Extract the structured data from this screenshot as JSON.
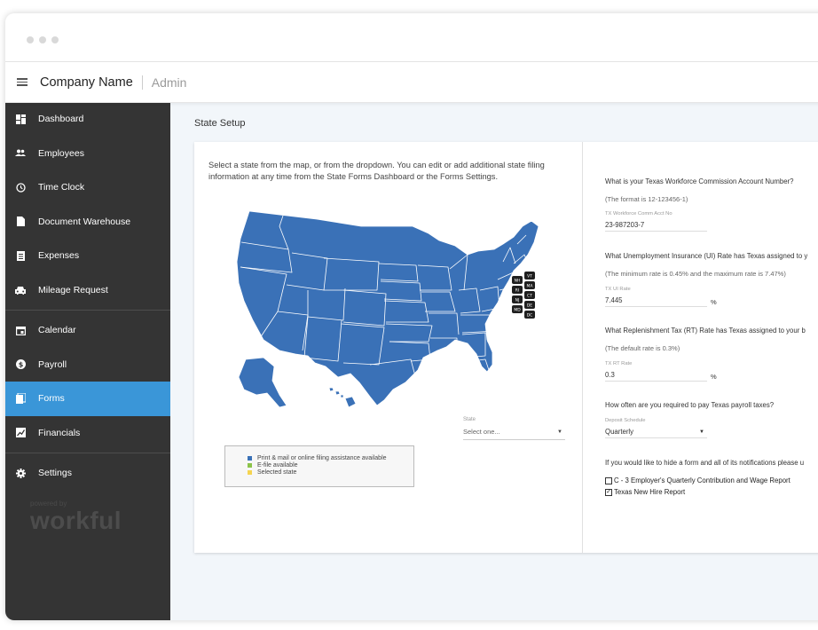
{
  "header": {
    "company": "Company Name",
    "section": "Admin"
  },
  "sidebar": {
    "items": [
      {
        "label": "Dashboard",
        "icon": "dashboard-icon"
      },
      {
        "label": "Employees",
        "icon": "people-icon"
      },
      {
        "label": "Time Clock",
        "icon": "clock-icon"
      },
      {
        "label": "Document Warehouse",
        "icon": "document-icon"
      },
      {
        "label": "Expenses",
        "icon": "receipt-icon"
      },
      {
        "label": "Mileage Request",
        "icon": "car-icon"
      },
      {
        "label": "Calendar",
        "icon": "calendar-icon"
      },
      {
        "label": "Payroll",
        "icon": "dollar-icon"
      },
      {
        "label": "Forms",
        "icon": "forms-icon"
      },
      {
        "label": "Financials",
        "icon": "chart-icon"
      },
      {
        "label": "Settings",
        "icon": "gear-icon"
      }
    ],
    "active": "Forms",
    "powered_by": "powered by",
    "brand": "workful"
  },
  "main": {
    "title": "State Setup",
    "intro": "Select a state from the map, or from the dropdown. You can edit or add additional state filing information at any time from the State Forms Dashboard or the Forms Settings.",
    "map": {
      "fill_color": "#3a71b7",
      "small_states": [
        "NH",
        "VT",
        "RI",
        "MA",
        "NJ",
        "CT",
        "MD",
        "DE",
        "DC"
      ]
    },
    "state_select": {
      "label": "State",
      "value": "Select one..."
    },
    "legend": [
      {
        "label": "Print & mail or online filing assistance available",
        "color": "#3a71b7"
      },
      {
        "label": "E-file available",
        "color": "#8bc34a"
      },
      {
        "label": "Selected state",
        "color": "#f5d451"
      }
    ]
  },
  "form": {
    "q1": "What is your Texas Workforce Commission Account Number?",
    "q1_hint": "(The format is 12-123456-1)",
    "q1_label": "TX Workforce Comm Acct No",
    "q1_value": "23-987203-7",
    "q2": "What Unemployment Insurance (UI) Rate has Texas assigned to y",
    "q2_hint": "(The minimum rate is 0.45% and the maximum rate is 7.47%)",
    "q2_label": "TX UI Rate",
    "q2_value": "7.445",
    "q2_unit": "%",
    "q3": "What Replenishment Tax (RT) Rate has Texas assigned to your b",
    "q3_hint": "(The default rate is 0.3%)",
    "q3_label": "TX RT Rate",
    "q3_value": "0.3",
    "q3_unit": "%",
    "q4": "How often are you required to pay Texas payroll taxes?",
    "q4_label": "Deposit Schedule",
    "q4_value": "Quarterly",
    "hide_text": "If you would like to hide a form and all of its notifications please u",
    "checkboxes": [
      {
        "label": "C - 3 Employer's Quarterly Contribution and Wage Report",
        "checked": false
      },
      {
        "label": "Texas New Hire Report",
        "checked": true
      }
    ]
  }
}
